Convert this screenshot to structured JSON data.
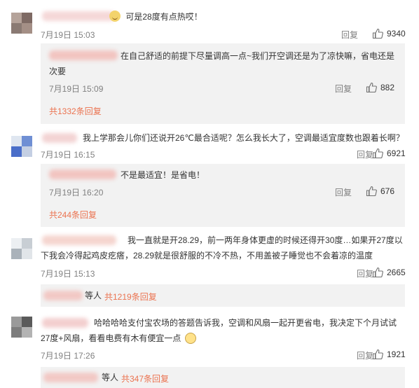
{
  "comments": [
    {
      "text": "可是28度有点热哎！",
      "time": "7月19日 15:03",
      "reply_label": "回复",
      "likes": "9340",
      "sub": {
        "text": "在自己舒适的前提下尽量调高一点~我们开空调还是为了凉快嘛，省电还是次要",
        "time": "7月19日 15:09",
        "reply_label": "回复",
        "likes": "882"
      },
      "more": "共1332条回复"
    },
    {
      "text": "我上学那会儿你们还说开26℃最合适呢？怎么我长大了，空调最适宜度数也跟着长啊？",
      "time": "7月19日 16:15",
      "reply_label": "回复",
      "likes": "6921",
      "sub": {
        "text": "不是最适宜！是省电！",
        "time": "7月19日 16:20",
        "reply_label": "回复",
        "likes": "676"
      },
      "more": "共244条回复"
    },
    {
      "text_line1": "我一直就是开28.29，前一两年身体更虚的时候还得开30度…如果开27度以",
      "text_line2": "下我会冷得起鸡皮疙瘩，28.29就是很舒服的不冷不热，不用盖被子睡觉也不会着凉的温度",
      "time": "7月19日 15:13",
      "reply_label": "回复",
      "likes": "2665",
      "others": "等人",
      "more": "共1219条回复"
    },
    {
      "text_line1": "哈哈哈哈支付宝农场的答题告诉我，空调和风扇一起开更省电，我决定下个月试试",
      "text_line2": "27度+风扇，看看电费有木有便宜一点",
      "time": "7月19日 17:26",
      "reply_label": "回复",
      "likes": "1921",
      "others": "等人",
      "more": "共347条回复"
    }
  ],
  "colors": {
    "link": "#eb7350",
    "muted": "#808080",
    "subbox": "#f2f2f2"
  },
  "icons": {
    "like": "thumbs-up-icon",
    "emoji_c1": "grin-emoji-icon",
    "emoji_c4": "smile-face-emoji-icon"
  }
}
